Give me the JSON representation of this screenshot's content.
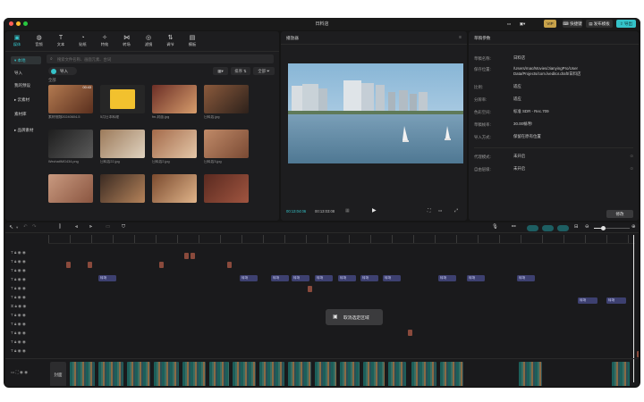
{
  "window": {
    "title": "日料店"
  },
  "titlebar": {
    "pro_badge": "VIP",
    "shortcut_label": "快捷键",
    "publish_label": "发布模板",
    "export_label": "导出"
  },
  "toolbar": {
    "items": [
      {
        "label": "媒体",
        "icon": "media-icon"
      },
      {
        "label": "音频",
        "icon": "audio-icon"
      },
      {
        "label": "文本",
        "icon": "text-icon"
      },
      {
        "label": "贴纸",
        "icon": "sticker-icon"
      },
      {
        "label": "特效",
        "icon": "effect-icon"
      },
      {
        "label": "转场",
        "icon": "transition-icon"
      },
      {
        "label": "滤镜",
        "icon": "filter-icon"
      },
      {
        "label": "调节",
        "icon": "adjust-icon"
      },
      {
        "label": "模板",
        "icon": "template-icon"
      }
    ]
  },
  "media_sidebar": {
    "items": [
      "本地",
      "导入",
      "我的预设",
      "云素材",
      "素材库",
      "品牌素材"
    ]
  },
  "media": {
    "search_placeholder": "搜索文件名称、画面元素、台词",
    "import_label": "导入",
    "section_label": "全部",
    "sort_label": "排序",
    "filter_label": "全部",
    "thumbs": [
      {
        "label": "素材视频20240604-5",
        "duration": "00:43"
      },
      {
        "label": "5月日本料理",
        "duration": ""
      },
      {
        "label": "fm-封面.jpg",
        "duration": ""
      },
      {
        "label": "日料店.jpg",
        "duration": ""
      },
      {
        "label": "WechatIMG434.png",
        "duration": ""
      },
      {
        "label": "日料店22.jpg",
        "duration": ""
      },
      {
        "label": "日料店2.jpg",
        "duration": ""
      },
      {
        "label": "日料店3.jpg",
        "duration": ""
      },
      {
        "label": "",
        "duration": ""
      },
      {
        "label": "",
        "duration": ""
      },
      {
        "label": "",
        "duration": ""
      },
      {
        "label": "",
        "duration": ""
      }
    ]
  },
  "player": {
    "title": "播放器",
    "current_time": "00:13:04:06",
    "total_time": "00:13:03:08"
  },
  "draft": {
    "title": "草稿参数",
    "rows": [
      {
        "label": "草稿名称:",
        "value": "日料店"
      },
      {
        "label": "保存位置:",
        "value": "/Users/mac/Movies/JianyingPro/User Data/Projects/com.lveditor.draft/日料店"
      },
      {
        "label": "比例:",
        "value": "适应"
      },
      {
        "label": "分辨率:",
        "value": "适应"
      },
      {
        "label": "色彩空间:",
        "value": "标准 SDR - Rec.709"
      },
      {
        "label": "草稿帧率:",
        "value": "30.00帧/秒"
      },
      {
        "label": "导入方式:",
        "value": "保留在原有位置"
      },
      {
        "label": "代理模式:",
        "value": "未开启"
      },
      {
        "label": "自由层级:",
        "value": "未开启"
      }
    ],
    "modify_label": "修改"
  },
  "timeline": {
    "toast": "取消选定区域",
    "cover_label": "封面",
    "chips": [
      "转场",
      "转场",
      "转场",
      "转场",
      "转场",
      "转场",
      "转场",
      "转场",
      "转场",
      "转场",
      "转场",
      "转场",
      "转场"
    ]
  },
  "colors": {
    "accent": "#35c3c9",
    "panel": "#1d1d1f",
    "chip": "#3d4070"
  }
}
